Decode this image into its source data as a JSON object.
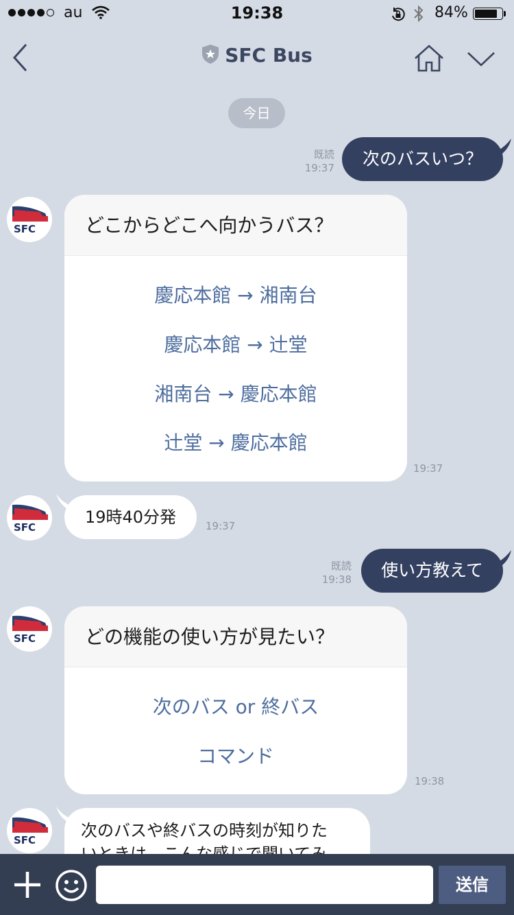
{
  "status": {
    "carrier": "au",
    "time": "19:38",
    "battery": "84%",
    "battery_level": 0.84
  },
  "nav": {
    "title": "SFC Bus"
  },
  "date_divider": "今日",
  "messages": {
    "sent1": {
      "text": "次のバスいつ？",
      "read": "既読",
      "time": "19:37"
    },
    "card1": {
      "title": "どこからどこへ向かうバス？",
      "actions": [
        "慶応本館 → 湘南台",
        "慶応本館 → 辻堂",
        "湘南台 → 慶応本館",
        "辻堂 → 慶応本館"
      ],
      "time": "19:37"
    },
    "recv1": {
      "text": "19時40分発",
      "time": "19:37"
    },
    "sent2": {
      "text": "使い方教えて",
      "read": "既読",
      "time": "19:38"
    },
    "card2": {
      "title": "どの機能の使い方が見たい？",
      "actions": [
        "次のバス or 終バス",
        "コマンド"
      ],
      "time": "19:38"
    },
    "recv2": {
      "line1": "次のバスや終バスの時刻が知りた",
      "line2": "いときは、こんな感じで聞いてみ"
    }
  },
  "input": {
    "placeholder": "",
    "send_label": "送信"
  },
  "colors": {
    "background": "#d5dbe5",
    "sent_bubble": "#334060",
    "link": "#4d6d9e",
    "input_bar": "#333e52",
    "send_button": "#4d5d81"
  }
}
